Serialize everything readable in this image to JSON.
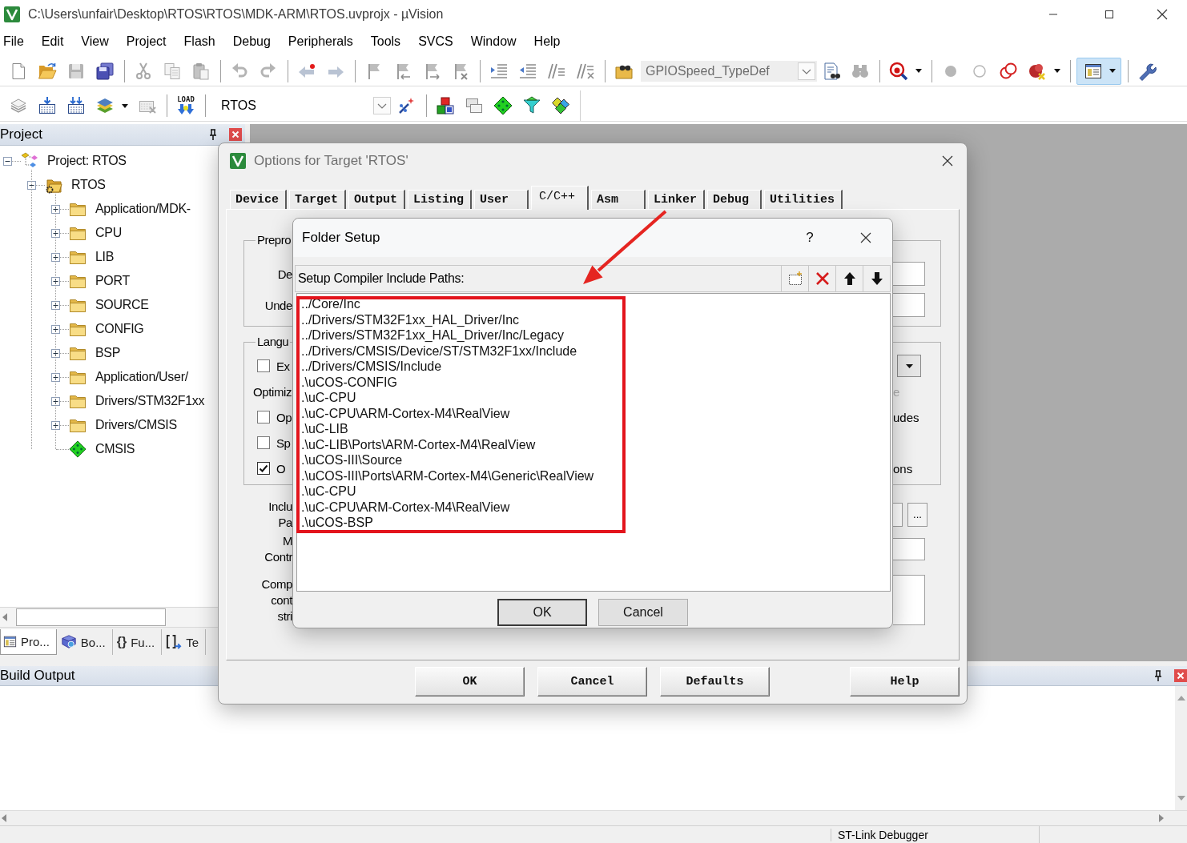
{
  "window": {
    "title": "C:\\Users\\unfair\\Desktop\\RTOS\\RTOS\\MDK-ARM\\RTOS.uvprojx - µVision"
  },
  "menu": [
    "File",
    "Edit",
    "View",
    "Project",
    "Flash",
    "Debug",
    "Peripherals",
    "Tools",
    "SVCS",
    "Window",
    "Help"
  ],
  "toolbar": {
    "find_field": {
      "value": "GPIOSpeed_TypeDef"
    },
    "layout_button": {
      "on": true
    }
  },
  "build_toolbar": {
    "load_button": {
      "label": "LOAD"
    },
    "target_field": {
      "value": "RTOS"
    }
  },
  "project_panel": {
    "title": "Project",
    "tree": [
      {
        "label": "Project: RTOS",
        "kind": "project",
        "expanded": true,
        "children": [
          {
            "label": "RTOS",
            "kind": "target",
            "expanded": true,
            "children": [
              {
                "label": "Application/MDK-",
                "kind": "folder",
                "expanded": false
              },
              {
                "label": "CPU",
                "kind": "folder",
                "expanded": false
              },
              {
                "label": "LIB",
                "kind": "folder",
                "expanded": false
              },
              {
                "label": "PORT",
                "kind": "folder",
                "expanded": false
              },
              {
                "label": "SOURCE",
                "kind": "folder",
                "expanded": false
              },
              {
                "label": "CONFIG",
                "kind": "folder",
                "expanded": false
              },
              {
                "label": "BSP",
                "kind": "folder",
                "expanded": false
              },
              {
                "label": "Application/User/",
                "kind": "folder",
                "expanded": false
              },
              {
                "label": "Drivers/STM32F1xx",
                "kind": "folder",
                "expanded": false
              },
              {
                "label": "Drivers/CMSIS",
                "kind": "folder",
                "expanded": false
              },
              {
                "label": "CMSIS",
                "kind": "component"
              }
            ]
          }
        ]
      }
    ],
    "tabs": [
      {
        "kind": "project",
        "label": "Pro...",
        "selected": true
      },
      {
        "kind": "books",
        "label": "Bo...",
        "selected": false
      },
      {
        "kind": "functions",
        "glyph": "{}",
        "label": "Fu...",
        "selected": false
      },
      {
        "kind": "templates",
        "label": "Te",
        "selected": false
      }
    ]
  },
  "build_output": {
    "title": "Build Output"
  },
  "status_bar": {
    "debugger": "ST-Link Debugger"
  },
  "options_dialog": {
    "title": "Options for Target 'RTOS'",
    "tabs": [
      {
        "label": "Device",
        "selected": false
      },
      {
        "label": "Target",
        "selected": false
      },
      {
        "label": "Output",
        "selected": false
      },
      {
        "label": "Listing",
        "selected": false
      },
      {
        "label": "User",
        "selected": false
      },
      {
        "label": "C/C++",
        "selected": true
      },
      {
        "label": "Asm",
        "selected": false
      },
      {
        "label": "Linker",
        "selected": false
      },
      {
        "label": "Debug",
        "selected": false
      },
      {
        "label": "Utilities",
        "selected": false
      }
    ],
    "preprocessor": {
      "title": "Prepro",
      "define_label": "De",
      "undefine_label": "Unde"
    },
    "language": {
      "title": "Langu",
      "rows": [
        {
          "left": {
            "kind": "checkbox",
            "label": "Ex",
            "checked": false
          },
          "right": {
            "kind": "dropdown"
          }
        },
        {
          "left": {
            "kind": "text",
            "label": "Optimiz",
            "disabled": false
          },
          "right": {
            "kind": "text",
            "label": "e",
            "disabled": true
          }
        },
        {
          "left": {
            "kind": "checkbox",
            "label": "Op",
            "checked": false
          },
          "right": {
            "kind": "text",
            "label": "udes",
            "disabled": false
          }
        },
        {
          "left": {
            "kind": "checkbox",
            "label": "Sp",
            "checked": false
          }
        },
        {
          "left": {
            "kind": "checkbox",
            "label": "O",
            "checked": true
          },
          "right": {
            "kind": "text",
            "label": "ons",
            "disabled": false
          }
        }
      ]
    },
    "fields": [
      {
        "kind": "browse",
        "label_lines": [
          "Inclu",
          "Pa"
        ],
        "button": "..."
      },
      {
        "kind": "line",
        "label_lines": [
          "M",
          "Contr"
        ]
      },
      {
        "kind": "box",
        "label_lines": [
          "Comp",
          "cont",
          "stri"
        ]
      }
    ],
    "buttons": [
      "OK",
      "Cancel",
      "Defaults",
      "Help"
    ]
  },
  "folder_dialog": {
    "title": "Folder Setup",
    "help": "?",
    "header": "Setup Compiler Include Paths:",
    "paths": [
      "../Core/Inc",
      "../Drivers/STM32F1xx_HAL_Driver/Inc",
      "../Drivers/STM32F1xx_HAL_Driver/Inc/Legacy",
      "../Drivers/CMSIS/Device/ST/STM32F1xx/Include",
      "../Drivers/CMSIS/Include",
      ".\\uCOS-CONFIG",
      ".\\uC-CPU",
      ".\\uC-CPU\\ARM-Cortex-M4\\RealView",
      ".\\uC-LIB",
      ".\\uC-LIB\\Ports\\ARM-Cortex-M4\\RealView",
      ".\\uCOS-III\\Source",
      ".\\uCOS-III\\Ports\\ARM-Cortex-M4\\Generic\\RealView",
      ".\\uC-CPU",
      ".\\uC-CPU\\ARM-Cortex-M4\\RealView",
      ".\\uCOS-BSP"
    ],
    "buttons": [
      {
        "label": "OK",
        "default": true
      },
      {
        "label": "Cancel",
        "default": false
      }
    ]
  }
}
